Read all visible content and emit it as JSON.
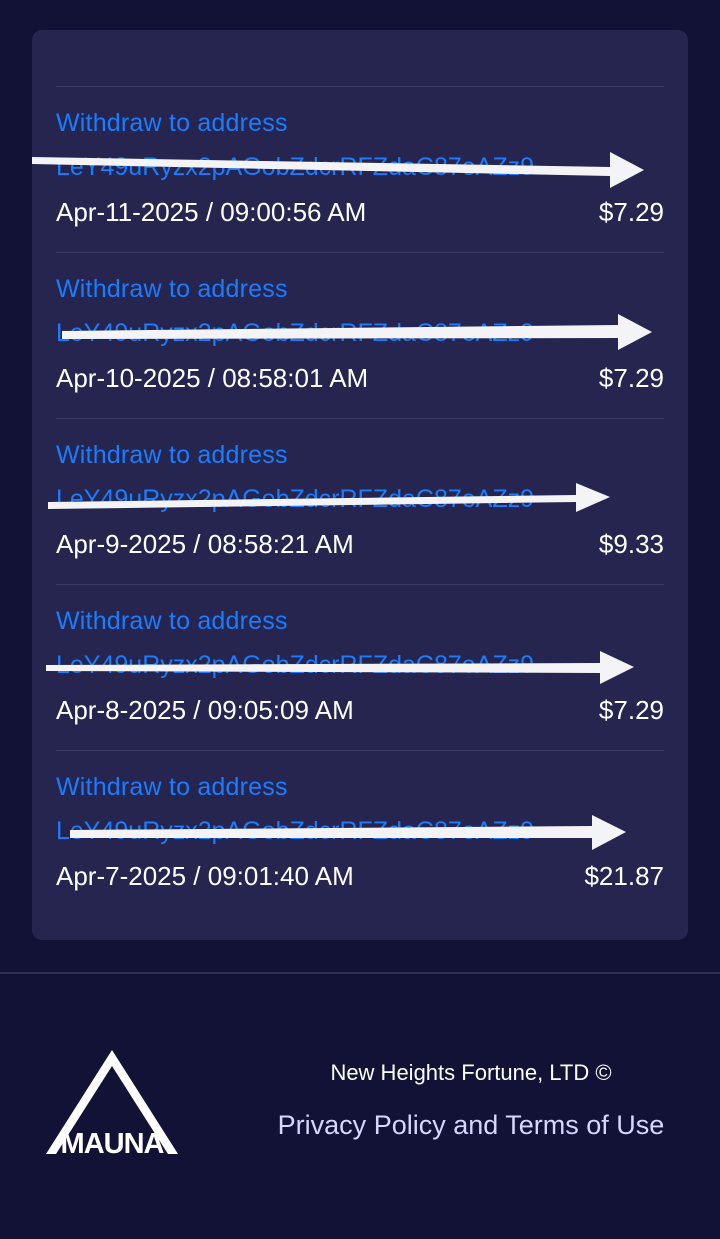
{
  "transactions": [
    {
      "title": "Withdraw to address",
      "address": "LeY49uRyzx2pAGobZdcrRFZdaC87eAZz9",
      "date": "Apr-11-2025 / 09:00:56 AM",
      "amount": "$7.29"
    },
    {
      "title": "Withdraw to address",
      "address": "LeY49uRyzx2pAGobZdcrRFZdaC87eAZz9",
      "date": "Apr-10-2025 / 08:58:01 AM",
      "amount": "$7.29"
    },
    {
      "title": "Withdraw to address",
      "address": "LeY49uRyzx2pAGobZdcrRFZdaC87eAZz9",
      "date": "Apr-9-2025 / 08:58:21 AM",
      "amount": "$9.33"
    },
    {
      "title": "Withdraw to address",
      "address": "LeY49uRyzx2pAGobZdcrRFZdaC87eAZz9",
      "date": "Apr-8-2025 / 09:05:09 AM",
      "amount": "$7.29"
    },
    {
      "title": "Withdraw to address",
      "address": "LeY49uRyzx2pAGobZdcrRFZdaC87eAZz9",
      "date": "Apr-7-2025 / 09:01:40 AM",
      "amount": "$21.87"
    }
  ],
  "footer": {
    "logo_text": "MAUNA",
    "company": "New Heights Fortune, LTD ©",
    "policy_link": "Privacy Policy and Terms of Use"
  },
  "colors": {
    "background": "#121236",
    "card": "#26254f",
    "link": "#1a7cff",
    "text": "#ffffff"
  },
  "icons": [
    "redaction-arrow-icon",
    "mountain-logo-icon"
  ]
}
